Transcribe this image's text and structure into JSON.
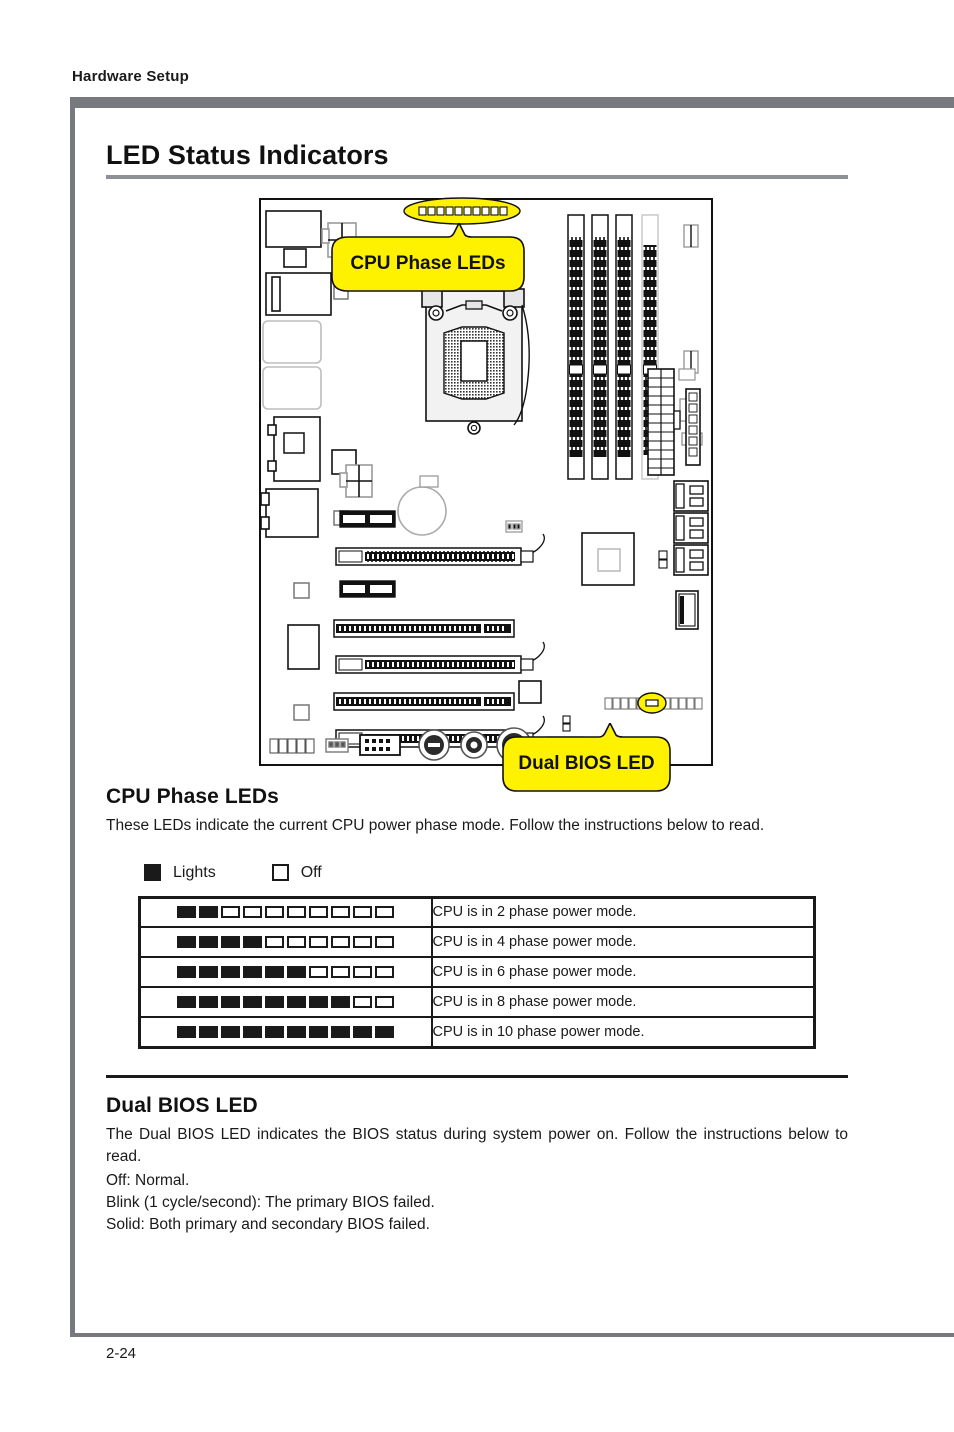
{
  "running_head": "Hardware Setup",
  "page_number": "2-24",
  "section": {
    "title": "LED Status Indicators"
  },
  "figure": {
    "callouts": [
      {
        "id": "cpu-phase-leds",
        "label": "CPU Phase LEDs"
      },
      {
        "id": "dual-bios-led",
        "label": "Dual BIOS LED"
      }
    ],
    "highlight_color": "#FFF200",
    "phase_led_count": 10
  },
  "cpu_phase": {
    "heading": "CPU Phase LEDs",
    "intro": "These LEDs indicate the current CPU power phase mode. Follow the instructions below to read.",
    "legend": [
      {
        "state": "on",
        "label": "Lights"
      },
      {
        "state": "off",
        "label": "Off"
      }
    ],
    "table": {
      "total_leds": 10,
      "rows": [
        {
          "on": 2,
          "off": 8,
          "description": "CPU is in 2 phase power mode."
        },
        {
          "on": 4,
          "off": 6,
          "description": "CPU is in 4 phase power mode."
        },
        {
          "on": 6,
          "off": 4,
          "description": "CPU is in 6 phase power mode."
        },
        {
          "on": 8,
          "off": 2,
          "description": "CPU is in 8 phase power mode."
        },
        {
          "on": 10,
          "off": 0,
          "description": "CPU is in 10 phase power mode."
        }
      ]
    }
  },
  "dual_bios": {
    "heading": "Dual BIOS LED",
    "intro": "The Dual BIOS LED indicates the BIOS status during system power on. Follow the instructions below to read.",
    "states": [
      "Off: Normal.",
      "Blink (1 cycle/second): The primary BIOS failed.",
      "Solid: Both primary and secondary BIOS failed."
    ]
  },
  "colors": {
    "rule_gray": "#76797E",
    "title_rule_gray": "#8D9095",
    "highlight_yellow": "#FFF200",
    "ink": "#1A1A1A"
  }
}
